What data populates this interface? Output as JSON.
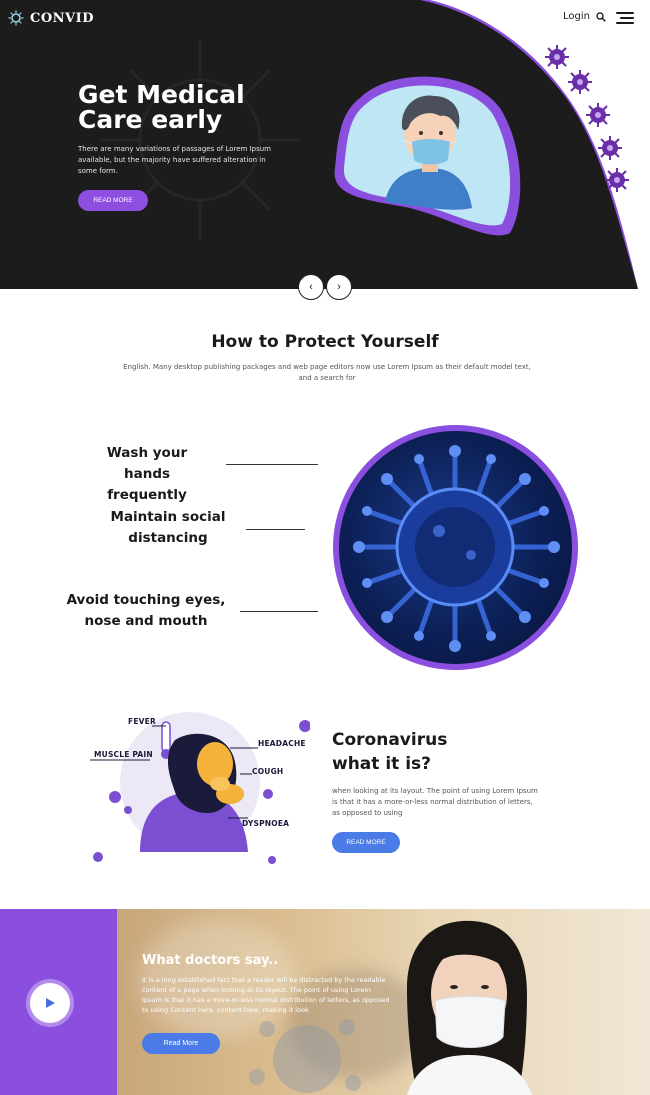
{
  "brand": {
    "name": "CONVID",
    "icon": "virus-logo-icon"
  },
  "nav": {
    "login": "Login",
    "search_icon": "search-icon",
    "menu_icon": "hamburger-menu-icon"
  },
  "hero": {
    "title_line1": "Get Medical",
    "title_line2": "Care early",
    "text": "There are many variations of passages of Lorem Ipsum available, but the majority have suffered alteration in some form.",
    "button": "READ MORE",
    "prev": "‹",
    "next": "›"
  },
  "protect": {
    "title": "How to Protect Yourself",
    "subtitle": "English. Many desktop publishing packages and web page editors now use Lorem Ipsum as their default model text, and a search for",
    "tips": [
      {
        "line1": "Wash your",
        "line2": "hands frequently"
      },
      {
        "line1": "Maintain social",
        "line2": "distancing"
      },
      {
        "line1": "Avoid touching eyes,",
        "line2": "nose and mouth"
      }
    ]
  },
  "corona": {
    "symptoms": [
      "FEVER",
      "MUSCLE PAIN",
      "HEADACHE",
      "COUGH",
      "DYSPNOEA"
    ],
    "title_line1": "Coronavirus",
    "title_line2": "what it is?",
    "text": "when looking at its layout. The point of using Lorem Ipsum is that it has a more-or-less normal distribution of letters, as opposed to using",
    "button": "READ MORE"
  },
  "doctors": {
    "title": "What doctors say..",
    "text": "It is a long established fact that a reader will be distracted by the readable content of a page when looking at its layout. The point of using Lorem Ipsum is that it has a more-or-less normal distribution of letters, as opposed to using Content here, content here, making it look",
    "button": "Read More",
    "play_icon": "play-icon"
  },
  "colors": {
    "purple": "#8b4fe0",
    "blue": "#4a7be6",
    "dark": "#1c1c1c"
  }
}
